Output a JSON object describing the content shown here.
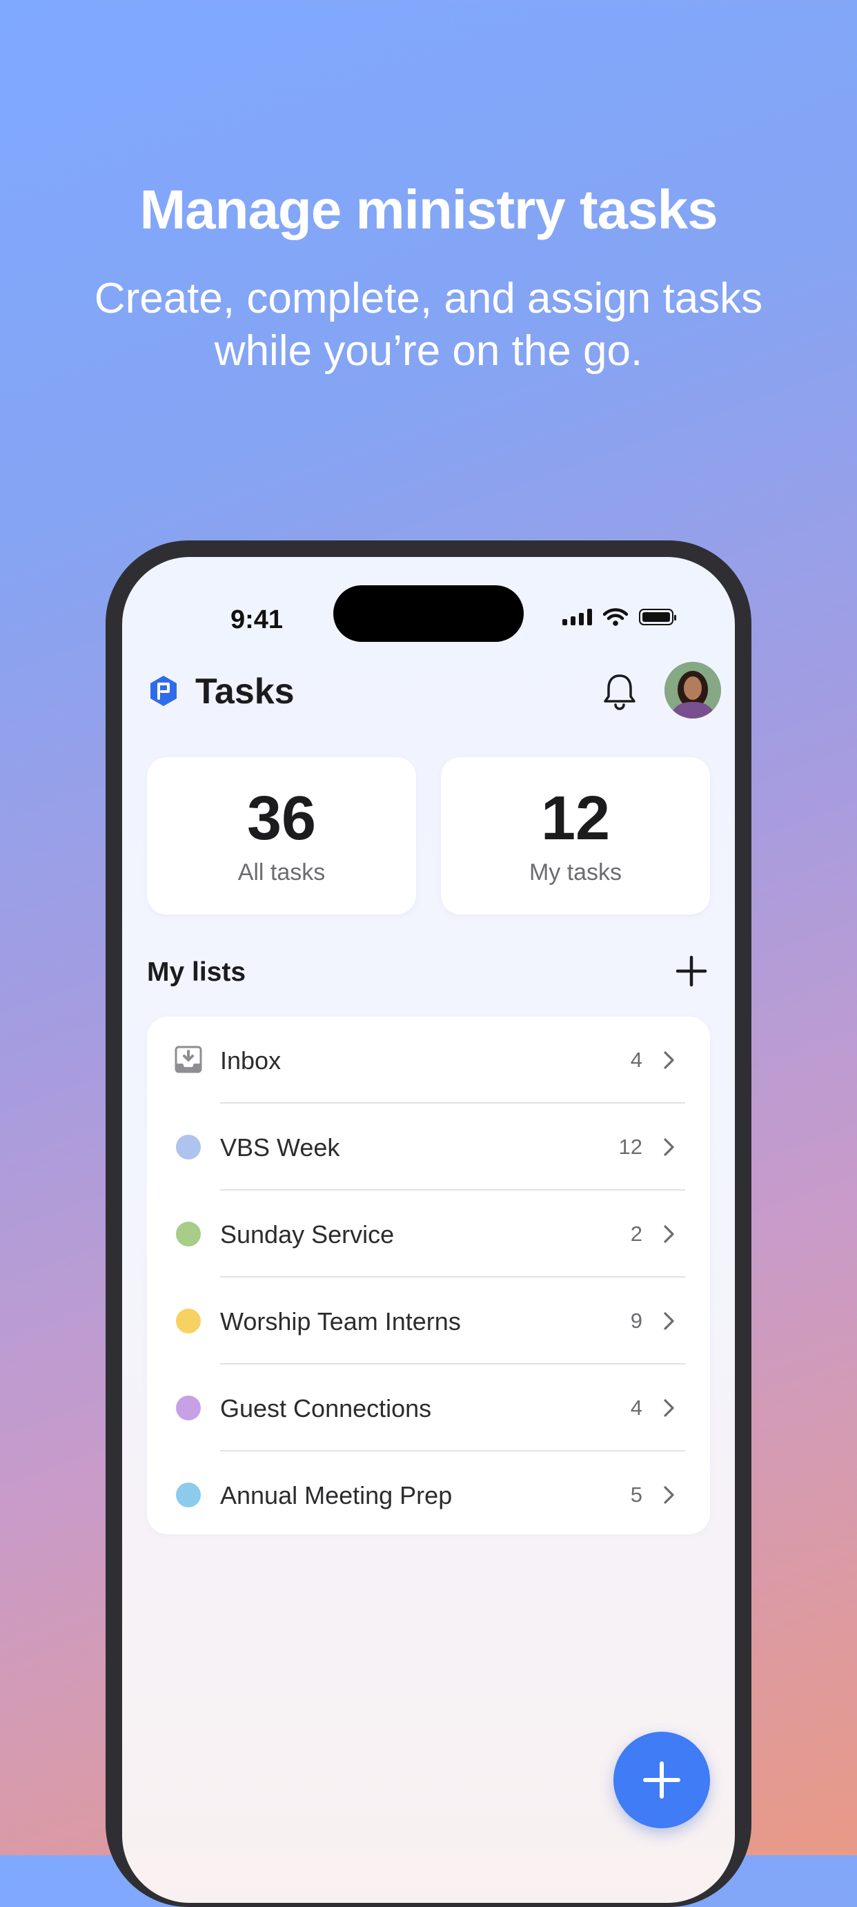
{
  "hero": {
    "title": "Manage ministry tasks",
    "subtitle": "Create, complete, and assign tasks while you’re on the go."
  },
  "status_bar": {
    "time": "9:41"
  },
  "app": {
    "title": "Tasks",
    "logo_icon": "flag-shield-icon",
    "accent": "#2f6bea"
  },
  "stats": [
    {
      "value": "36",
      "label": "All tasks"
    },
    {
      "value": "12",
      "label": "My tasks"
    }
  ],
  "lists_section": {
    "heading": "My lists"
  },
  "lists": [
    {
      "name": "Inbox",
      "count": "4",
      "icon": "inbox-icon"
    },
    {
      "name": "VBS Week",
      "count": "12",
      "color": "#aec3ee"
    },
    {
      "name": "Sunday Service",
      "count": "2",
      "color": "#a7cd88"
    },
    {
      "name": "Worship Team Interns",
      "count": "9",
      "color": "#f8d163"
    },
    {
      "name": "Guest Connections",
      "count": "4",
      "color": "#c8a0e6"
    },
    {
      "name": "Annual Meeting Prep",
      "count": "5",
      "color": "#8ccbeb"
    }
  ],
  "fab": {
    "icon": "plus-icon",
    "color": "#3f7cf5"
  }
}
